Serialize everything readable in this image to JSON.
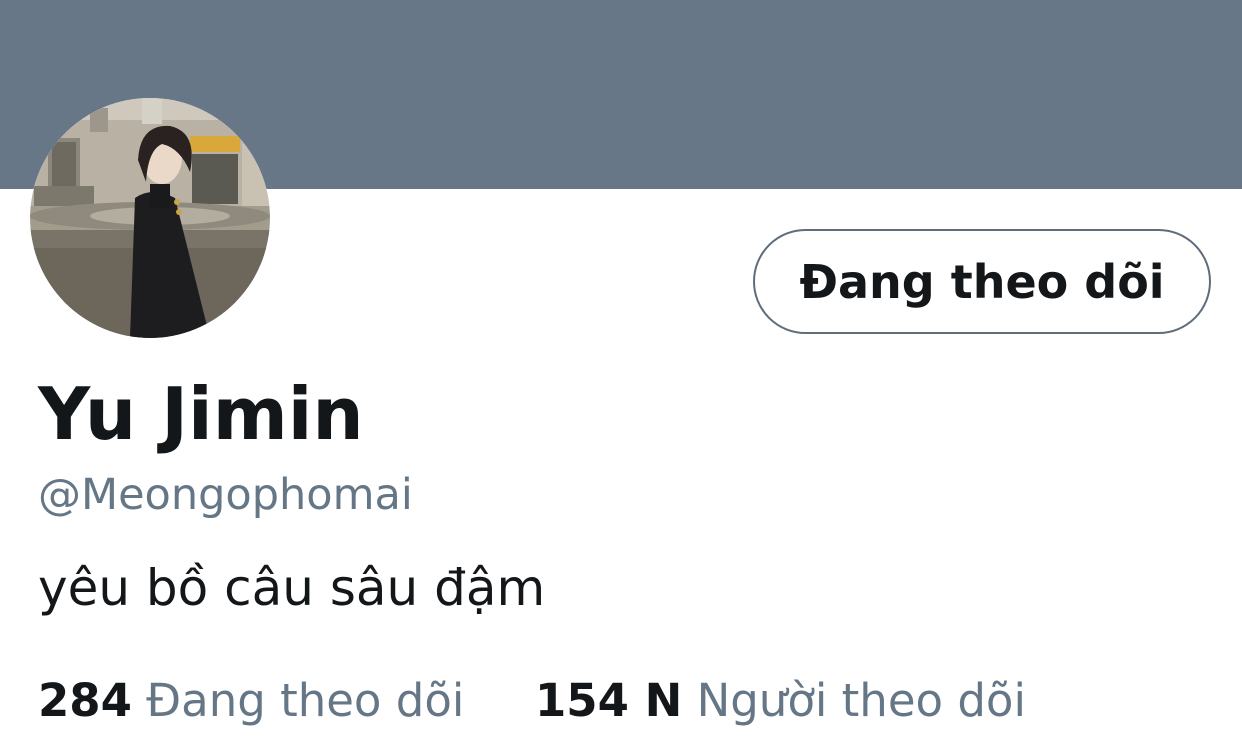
{
  "profile": {
    "follow_button_label": "Đang theo dõi",
    "display_name": "Yu Jimin",
    "handle": "@Meongophomai",
    "bio": "yêu bồ câu sâu đậm"
  },
  "stats": {
    "following_count": "284",
    "following_label": "Đang theo dõi",
    "followers_count": "154 N",
    "followers_label": "Người theo dõi"
  },
  "colors": {
    "banner": "#687787",
    "text_primary": "#14171a",
    "text_secondary": "#657786"
  }
}
